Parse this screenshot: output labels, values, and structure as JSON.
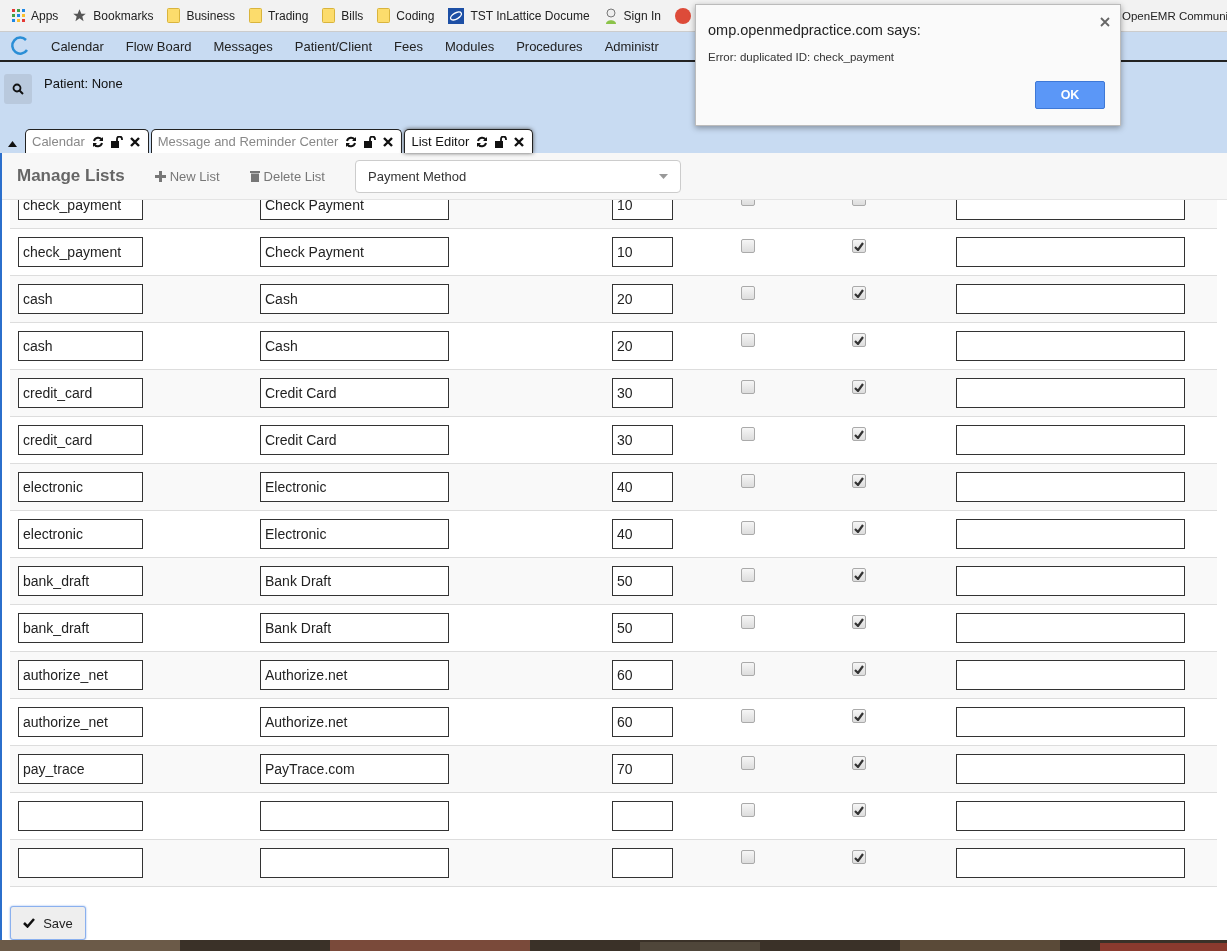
{
  "bookmarks": [
    {
      "kind": "apps",
      "label": "Apps"
    },
    {
      "kind": "star",
      "label": "Bookmarks"
    },
    {
      "kind": "folder",
      "label": "Business"
    },
    {
      "kind": "folder",
      "label": "Trading"
    },
    {
      "kind": "folder",
      "label": "Bills"
    },
    {
      "kind": "folder",
      "label": "Coding"
    },
    {
      "kind": "site",
      "label": "TST InLattice Docume"
    },
    {
      "kind": "person",
      "label": "Sign In"
    },
    {
      "kind": "google"
    }
  ],
  "bookmarks_right": {
    "label": "OpenEMR Communi"
  },
  "nav": {
    "items": [
      "Calendar",
      "Flow Board",
      "Messages",
      "Patient/Client",
      "Fees",
      "Modules",
      "Procedures",
      "Administr"
    ]
  },
  "patient_label": "Patient: None",
  "tabs": [
    {
      "label": "Calendar",
      "selected": false
    },
    {
      "label": "Message and Reminder Center",
      "selected": false
    },
    {
      "label": "List Editor",
      "selected": true
    }
  ],
  "toolbar": {
    "title": "Manage Lists",
    "actions": [
      {
        "kind": "plus",
        "label": "New List"
      },
      {
        "kind": "trash",
        "label": "Delete List"
      }
    ],
    "list_select": "Payment Method"
  },
  "rows": [
    {
      "id": "check_payment",
      "title": "Check Payment",
      "order": "10",
      "checked_1": false,
      "checked_2": false
    },
    {
      "id": "check_payment",
      "title": "Check Payment",
      "order": "10",
      "checked_1": false,
      "checked_2": true
    },
    {
      "id": "cash",
      "title": "Cash",
      "order": "20",
      "checked_1": false,
      "checked_2": true
    },
    {
      "id": "cash",
      "title": "Cash",
      "order": "20",
      "checked_1": false,
      "checked_2": true
    },
    {
      "id": "credit_card",
      "title": "Credit Card",
      "order": "30",
      "checked_1": false,
      "checked_2": true
    },
    {
      "id": "credit_card",
      "title": "Credit Card",
      "order": "30",
      "checked_1": false,
      "checked_2": true
    },
    {
      "id": "electronic",
      "title": "Electronic",
      "order": "40",
      "checked_1": false,
      "checked_2": true
    },
    {
      "id": "electronic",
      "title": "Electronic",
      "order": "40",
      "checked_1": false,
      "checked_2": true
    },
    {
      "id": "bank_draft",
      "title": "Bank Draft",
      "order": "50",
      "checked_1": false,
      "checked_2": true
    },
    {
      "id": "bank_draft",
      "title": "Bank Draft",
      "order": "50",
      "checked_1": false,
      "checked_2": true
    },
    {
      "id": "authorize_net",
      "title": "Authorize.net",
      "order": "60",
      "checked_1": false,
      "checked_2": true
    },
    {
      "id": "authorize_net",
      "title": "Authorize.net",
      "order": "60",
      "checked_1": false,
      "checked_2": true
    },
    {
      "id": "pay_trace",
      "title": "PayTrace.com",
      "order": "70",
      "checked_1": false,
      "checked_2": true
    },
    {
      "checked_1": false,
      "checked_2": true
    },
    {
      "checked_1": false,
      "checked_2": true
    }
  ],
  "save_button": "Save",
  "dialog": {
    "title": "omp.openmedpractice.com says:",
    "message": "Error: duplicated ID: check_payment",
    "button": "OK"
  }
}
